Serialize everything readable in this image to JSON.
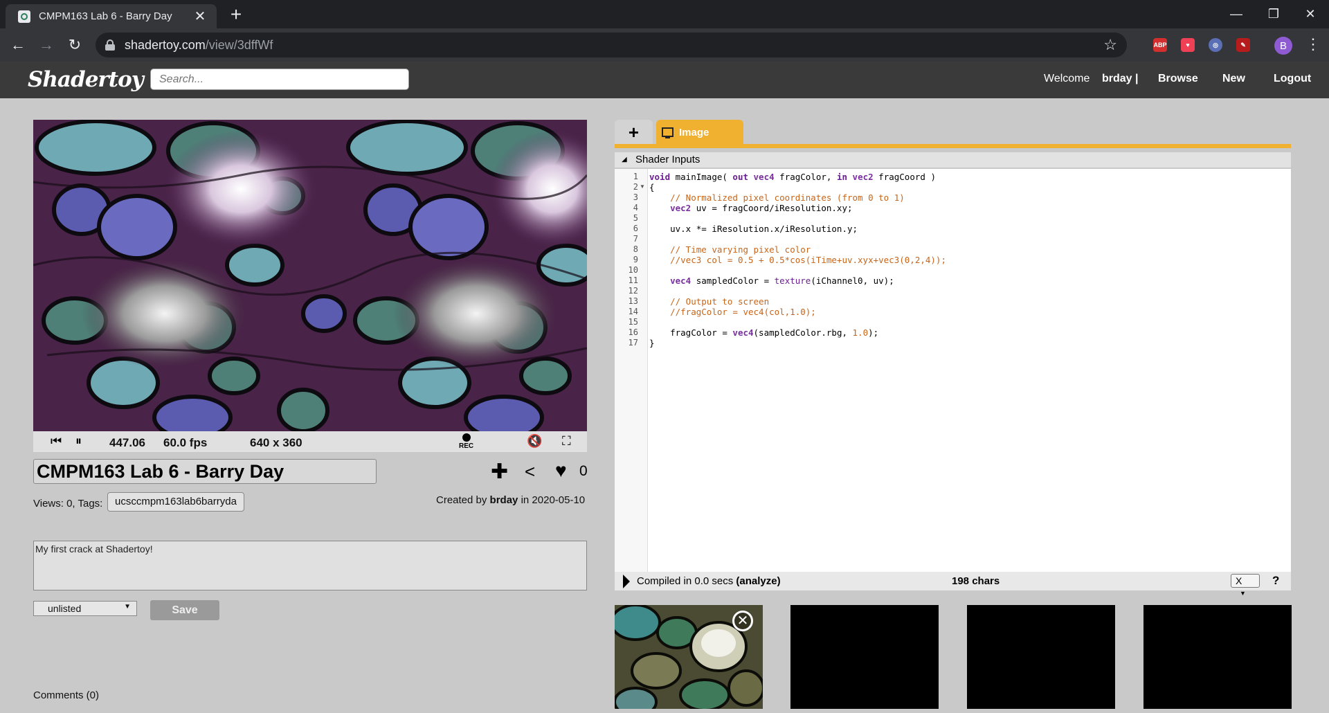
{
  "browser": {
    "tab_title": "CMPM163 Lab 6 - Barry Day",
    "url_host": "shadertoy.com",
    "url_path": "/view/3dffWf",
    "profile_initial": "B",
    "extensions": [
      {
        "name": "adblock-icon",
        "label": "ABP",
        "color": "#d32f2f"
      },
      {
        "name": "pocket-icon",
        "label": "",
        "color": "#ef4056"
      },
      {
        "name": "extension-icon",
        "label": "",
        "color": "#7b8ec8"
      },
      {
        "name": "pdf-icon",
        "label": "",
        "color": "#b71c1c"
      }
    ]
  },
  "site": {
    "logo": "Shadertoy",
    "search_placeholder": "Search...",
    "nav": {
      "welcome": "Welcome",
      "user": "brday |",
      "browse": "Browse",
      "new": "New",
      "logout": "Logout"
    }
  },
  "player": {
    "time": "447.06",
    "fps": "60.0 fps",
    "resolution": "640 x 360",
    "rec_label": "REC"
  },
  "shader": {
    "title": "CMPM163 Lab 6 - Barry Day",
    "likes": "0",
    "views_label": "Views: 0, Tags:",
    "tag": "ucsccmpm163lab6barryda",
    "created_prefix": "Created by",
    "created_user": "brday",
    "created_suffix": "in 2020-05-10",
    "description": "My first crack at Shadertoy!",
    "visibility": "unlisted",
    "save_label": "Save",
    "comments_label": "Comments (0)"
  },
  "editor": {
    "add_tab_label": "+",
    "tab_label": "Image",
    "shader_inputs_label": "Shader Inputs",
    "line_numbers": [
      "1",
      "2",
      "3",
      "4",
      "5",
      "6",
      "7",
      "8",
      "9",
      "10",
      "11",
      "12",
      "13",
      "14",
      "15",
      "16",
      "17"
    ],
    "compiled_label": "Compiled in 0.0 secs",
    "analyze_label": "(analyze)",
    "chars_label": "198 chars",
    "x_select": "X",
    "help_label": "?"
  },
  "channels": [
    "iChannel0",
    "iChannel1",
    "iChannel2",
    "iChannel3"
  ]
}
